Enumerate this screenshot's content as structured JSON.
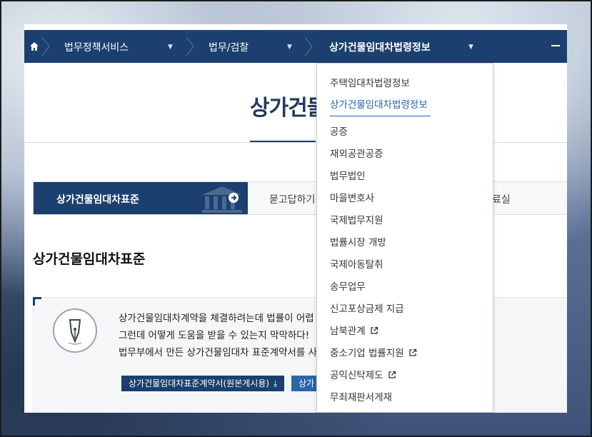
{
  "navbar": {
    "crumb1": "법무정책서비스",
    "crumb2": "법무/검찰",
    "crumb3": "상가건물임대차법령정보",
    "caret": "▼"
  },
  "page": {
    "title": "상가건물임대차법령정보"
  },
  "tabs": {
    "active": "상가건물임대차표준",
    "second": "묻고답하기",
    "third": "료실"
  },
  "section": {
    "title": "상가건물임대차표준"
  },
  "info": {
    "line1": "상가건물임대차계약을 체결하려는데 법률이 어렵",
    "line2": "그런데 어떻게 도움을 받을 수 있는지 막막하다!",
    "line3": "법무부에서 만든 상가건물임대차 표준계약서를 사",
    "download_button": "상가건물임대차표준계약서(원본게시용)",
    "download_button2": "상가",
    "download_icon": "⤓"
  },
  "dropdown": {
    "items": [
      {
        "label": "주택임대차법령정보",
        "external": false
      },
      {
        "label": "상가건물임대차법령정보",
        "external": false,
        "active": true
      },
      {
        "label": "공증",
        "external": false
      },
      {
        "label": "재외공관공증",
        "external": false
      },
      {
        "label": "법무법인",
        "external": false
      },
      {
        "label": "마을변호사",
        "external": false
      },
      {
        "label": "국제법무지원",
        "external": false
      },
      {
        "label": "법률시장 개방",
        "external": false
      },
      {
        "label": "국제아동탈취",
        "external": false
      },
      {
        "label": "송무업무",
        "external": false
      },
      {
        "label": "신고포상금제 지급",
        "external": false
      },
      {
        "label": "남북관계",
        "external": true
      },
      {
        "label": "중소기업 법률지원",
        "external": true
      },
      {
        "label": "공익신탁제도",
        "external": true
      },
      {
        "label": "무죄재판서게재",
        "external": false
      }
    ]
  },
  "colors": {
    "navy": "#1b3f6e",
    "link_active": "#1f63b5"
  }
}
